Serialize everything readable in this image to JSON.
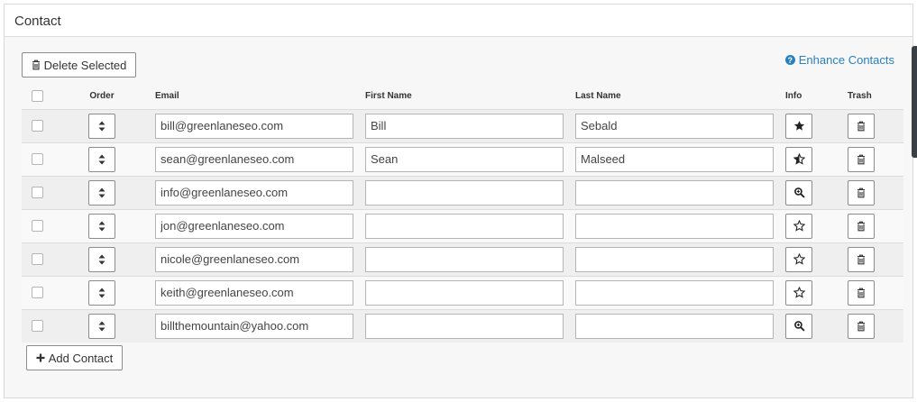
{
  "panel": {
    "title": "Contact"
  },
  "toolbar": {
    "delete_label": "Delete Selected",
    "enhance_label": "Enhance Contacts",
    "add_label": "Add Contact"
  },
  "table": {
    "headers": {
      "order": "Order",
      "email": "Email",
      "first_name": "First Name",
      "last_name": "Last Name",
      "info": "Info",
      "trash": "Trash"
    },
    "rows": [
      {
        "email": "bill@greenlaneseo.com",
        "first_name": "Bill",
        "last_name": "Sebald",
        "info_icon": "star-filled-icon"
      },
      {
        "email": "sean@greenlaneseo.com",
        "first_name": "Sean",
        "last_name": "Malseed",
        "info_icon": "star-half-icon"
      },
      {
        "email": "info@greenlaneseo.com",
        "first_name": "",
        "last_name": "",
        "info_icon": "zoom-in-icon"
      },
      {
        "email": "jon@greenlaneseo.com",
        "first_name": "",
        "last_name": "",
        "info_icon": "star-empty-icon"
      },
      {
        "email": "nicole@greenlaneseo.com",
        "first_name": "",
        "last_name": "",
        "info_icon": "star-empty-icon"
      },
      {
        "email": "keith@greenlaneseo.com",
        "first_name": "",
        "last_name": "",
        "info_icon": "star-empty-icon"
      },
      {
        "email": "billthemountain@yahoo.com",
        "first_name": "",
        "last_name": "",
        "info_icon": "zoom-in-icon"
      }
    ]
  },
  "colors": {
    "accent": "#2a7fbf"
  }
}
